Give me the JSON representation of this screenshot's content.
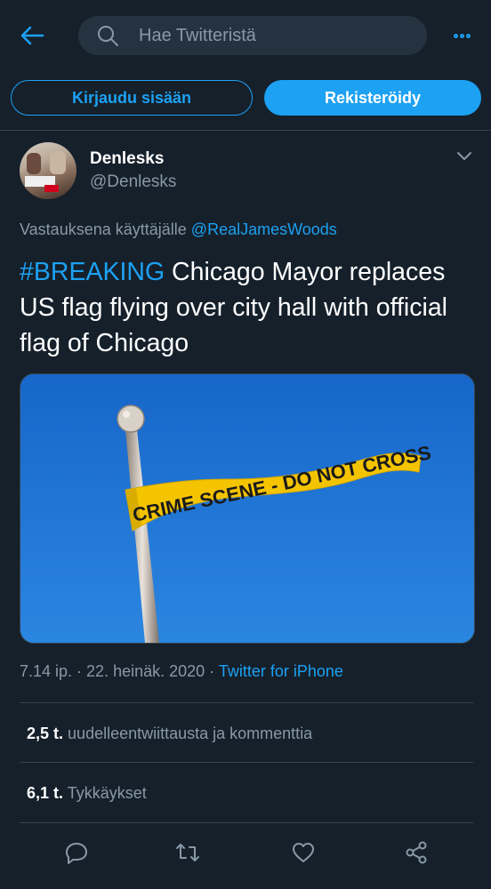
{
  "header": {
    "back_icon": "arrow-left-icon",
    "search_placeholder": "Hae Twitteristä",
    "more_icon": "more-horizontal-icon",
    "accent": "#1da1f2"
  },
  "auth": {
    "login_label": "Kirjaudu sisään",
    "signup_label": "Rekisteröidy"
  },
  "tweet": {
    "author_name": "Denlesks",
    "author_handle": "@Denlesks",
    "replying_prefix": "Vastauksena käyttäjälle",
    "replying_to": "@RealJamesWoods",
    "hashtag": "#BREAKING",
    "text": " Chicago Mayor replaces US flag flying over city hall with official flag of Chicago",
    "media_text": "CRIME SCENE - DO NOT CROSS",
    "time": "7.14 ip. · 22. heinäk. 2020 · ",
    "source": "Twitter for iPhone",
    "retweets_count": "2,5 t.",
    "retweets_label": "uudelleentwiittausta ja kommenttia",
    "likes_count": "6,1 t.",
    "likes_label": "Tykkäykset"
  },
  "actions": [
    {
      "icon": "reply-icon"
    },
    {
      "icon": "retweet-icon"
    },
    {
      "icon": "like-icon"
    },
    {
      "icon": "share-icon"
    }
  ],
  "colors": {
    "background": "#15202b",
    "accent": "#1da1f2",
    "muted": "#8899a6",
    "divider": "#38444d"
  }
}
